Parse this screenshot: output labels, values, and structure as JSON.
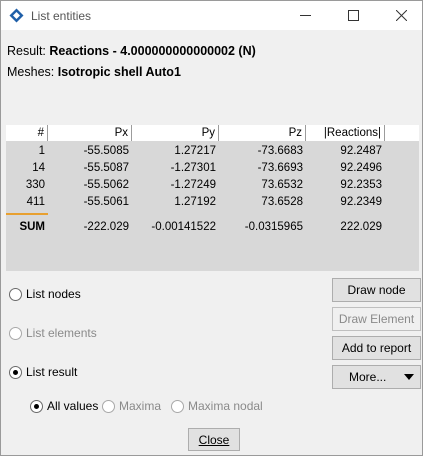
{
  "window": {
    "title": "List entities",
    "icon": "diamond-app-icon"
  },
  "info": {
    "result_label": "Result:",
    "result_name": "Reactions",
    "result_value": " - 4.000000000000002 (N)",
    "meshes_label": "Meshes:",
    "meshes_value": "Isotropic shell Auto1"
  },
  "table": {
    "columns": [
      "#",
      "Px",
      "Py",
      "Pz",
      "|Reactions|"
    ],
    "rows": [
      [
        "1",
        "-55.5085",
        "1.27217",
        "-73.6683",
        "92.2487"
      ],
      [
        "14",
        "-55.5087",
        "-1.27301",
        "-73.6693",
        "92.2496"
      ],
      [
        "330",
        "-55.5062",
        "-1.27249",
        "73.6532",
        "92.2353"
      ],
      [
        "411",
        "-55.5061",
        "1.27192",
        "73.6528",
        "92.2349"
      ]
    ],
    "sum": [
      "SUM",
      "-222.029",
      "-0.00141522",
      "-0.0315965",
      "222.029"
    ]
  },
  "options": {
    "list_nodes": "List nodes",
    "list_elements": "List elements",
    "list_result": "List result",
    "all_values": "All values",
    "maxima": "Maxima",
    "maxima_nodal": "Maxima nodal"
  },
  "buttons": {
    "draw_node": "Draw node",
    "draw_element": "Draw Element",
    "add_to_report": "Add to report",
    "more": "More...",
    "close": "Close"
  },
  "colors": {
    "table_background": "#d8d8d8",
    "selection_marker": "#e8a030",
    "app_icon": "#1f5fa8"
  }
}
